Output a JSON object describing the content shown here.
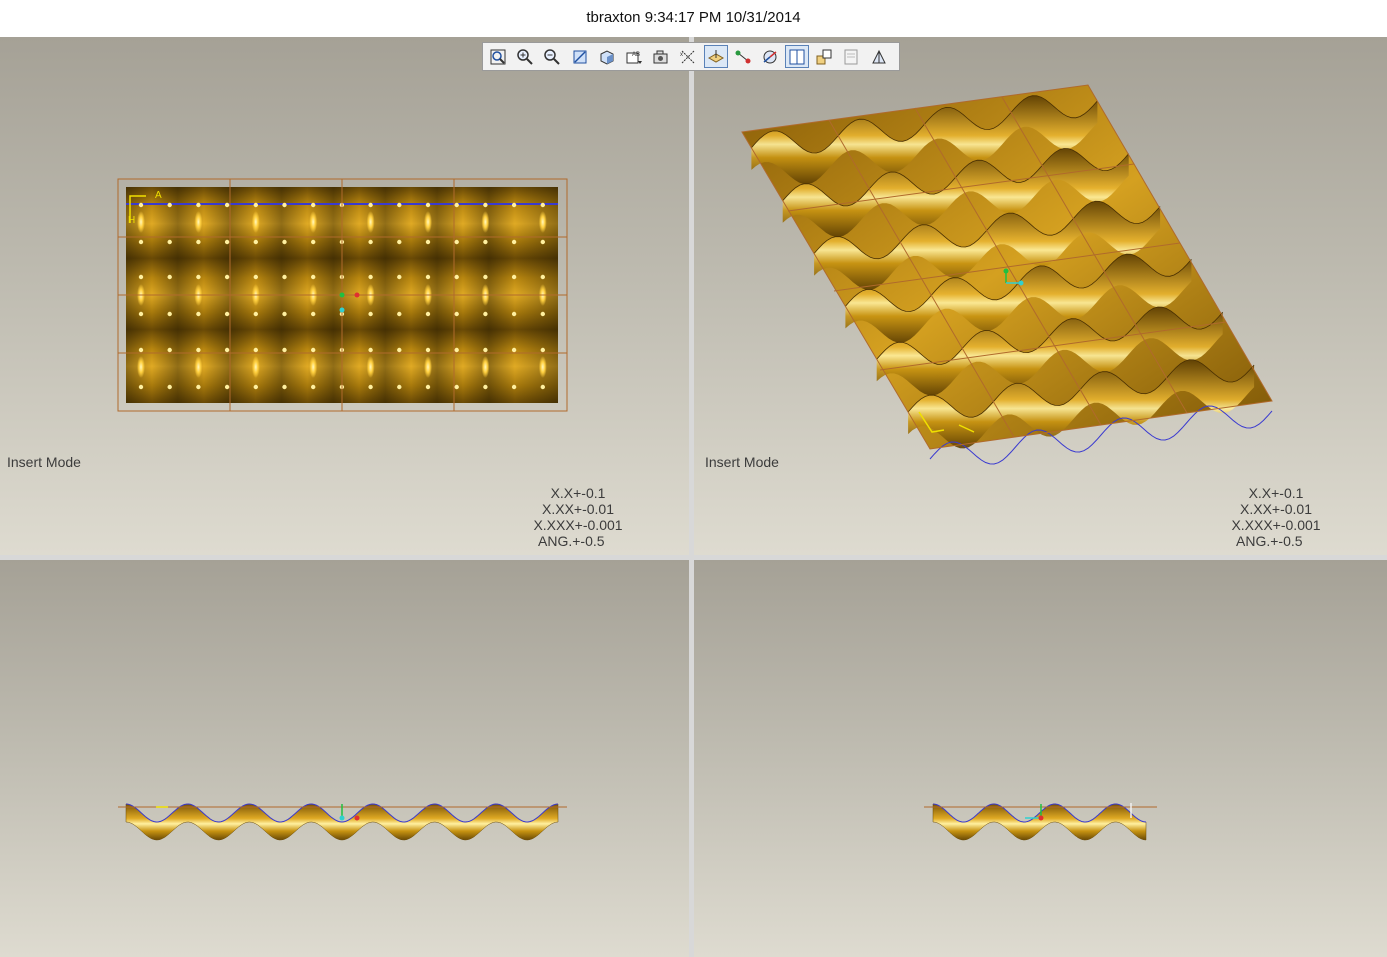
{
  "window": {
    "title": "tbraxton 9:34:17 PM 10/31/2014"
  },
  "toolbar": {
    "buttons": [
      {
        "name": "zoom-fit-icon",
        "active": false
      },
      {
        "name": "zoom-in-icon",
        "active": false
      },
      {
        "name": "zoom-out-icon",
        "active": false
      },
      {
        "name": "repaint-icon",
        "active": false
      },
      {
        "name": "shading-style-icon",
        "active": false
      },
      {
        "name": "saved-views-icon",
        "active": false
      },
      {
        "name": "view-manager-icon",
        "active": false
      },
      {
        "name": "datum-axes-icon",
        "active": false
      },
      {
        "name": "datum-planes-icon",
        "active": true
      },
      {
        "name": "datum-points-icon",
        "active": false
      },
      {
        "name": "csys-display-icon",
        "active": false
      },
      {
        "name": "multi-viewport-icon",
        "active": true
      },
      {
        "name": "spin-center-icon",
        "active": false
      },
      {
        "name": "annotation-display-icon",
        "active": false
      },
      {
        "name": "perspective-view-icon",
        "active": false
      }
    ]
  },
  "viewports": {
    "top_left": {
      "mode_label": "Insert Mode",
      "tolerances": [
        "X.X+-0.1",
        "X.XX+-0.01",
        "X.XXX+-0.001",
        "ANG.+-0.5"
      ]
    },
    "top_right": {
      "mode_label": "Insert Mode",
      "tolerances": [
        "X.X+-0.1",
        "X.XX+-0.01",
        "X.XXX+-0.001",
        "ANG.+-0.5"
      ]
    }
  },
  "colors": {
    "surface": "#c89412",
    "surface_dark": "#6a4a05",
    "highlight": "#fff0a0",
    "datum_plane": "#b06a2c",
    "edge": "#3a3ad0",
    "csys_x": "#e03030",
    "csys_y": "#20c040",
    "csys_z": "#30d0d0"
  }
}
